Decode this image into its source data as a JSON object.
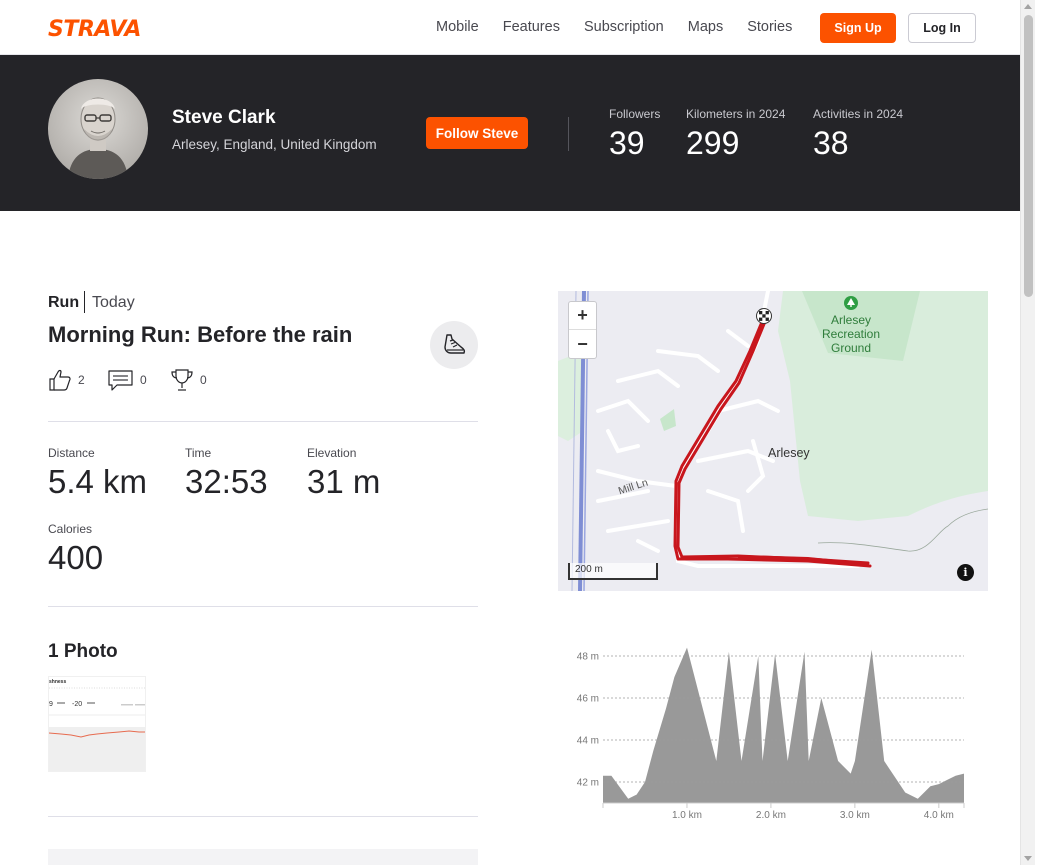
{
  "nav": {
    "logo": "STRAVA",
    "links": [
      "Mobile",
      "Features",
      "Subscription",
      "Maps",
      "Stories"
    ],
    "sign_up": "Sign Up",
    "log_in": "Log In"
  },
  "athlete": {
    "name": "Steve Clark",
    "location": "Arlesey, England, United Kingdom",
    "follow_label": "Follow Steve",
    "stats": [
      {
        "label": "Followers",
        "value": "39"
      },
      {
        "label": "Kilometers in 2024",
        "value": "299"
      },
      {
        "label": "Activities in 2024",
        "value": "38"
      }
    ]
  },
  "activity": {
    "type": "Run",
    "date": "Today",
    "title": "Morning Run: Before the rain",
    "kudos": "2",
    "comments": "0",
    "achievements": "0",
    "stats": [
      {
        "label": "Distance",
        "value": "5.4 km"
      },
      {
        "label": "Time",
        "value": "32:53"
      },
      {
        "label": "Elevation",
        "value": "31 m"
      },
      {
        "label": "Calories",
        "value": "400"
      }
    ],
    "photos_heading": "1 Photo",
    "photo_thumb": {
      "title": "shness",
      "num_a": "9",
      "num_b": "-20"
    }
  },
  "map": {
    "zoom_in": "+",
    "zoom_out": "−",
    "scale_label": "200 m",
    "labels": {
      "park": "Arlesey Recreation Ground",
      "town": "Arlesey",
      "street": "Mill Ln"
    },
    "info": "i",
    "route_color": "#c8161d"
  },
  "chart_data": {
    "type": "area",
    "ylabel": "",
    "xlabel": "",
    "y_ticks": [
      "42 m",
      "44 m",
      "46 m",
      "48 m"
    ],
    "x_ticks": [
      "1.0 km",
      "2.0 km",
      "3.0 km",
      "4.0 km"
    ],
    "ylim": [
      41.0,
      49.0
    ],
    "xlim": [
      0,
      4.3
    ],
    "grid": true,
    "x": [
      0,
      0.1,
      0.3,
      0.4,
      0.5,
      0.6,
      0.75,
      0.85,
      1.0,
      1.35,
      1.5,
      1.65,
      1.85,
      1.9,
      2.05,
      2.2,
      2.4,
      2.45,
      2.6,
      2.8,
      2.95,
      3.0,
      3.2,
      3.35,
      3.5,
      3.6,
      3.75,
      3.9,
      4.0,
      4.1,
      4.2,
      4.3
    ],
    "y": [
      42.3,
      42.3,
      41.2,
      41.4,
      42.0,
      43.5,
      45.5,
      47.0,
      48.4,
      43.0,
      48.2,
      43.0,
      48.0,
      43.0,
      48.1,
      43.0,
      48.2,
      43.0,
      46.0,
      43.0,
      42.4,
      43.0,
      48.3,
      43.0,
      42.1,
      41.5,
      41.2,
      41.8,
      41.9,
      42.1,
      42.3,
      42.4
    ],
    "fill_color": "#999999"
  }
}
